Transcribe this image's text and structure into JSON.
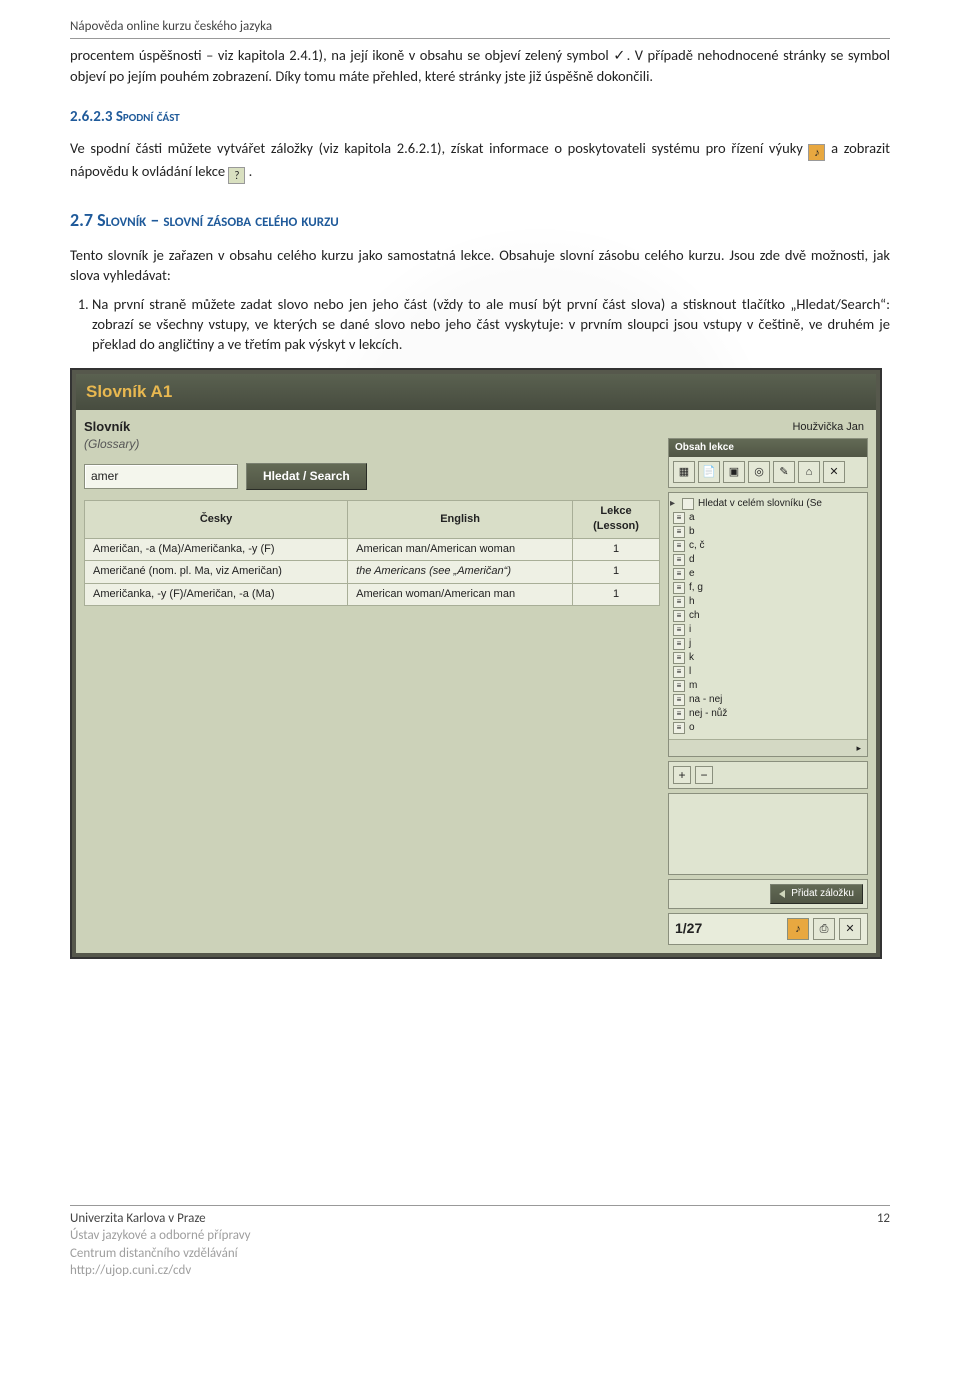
{
  "header": {
    "title": "Nápověda online kurzu českého jazyka"
  },
  "paragraphs": {
    "p1": "procentem úspěšnosti – viz kapitola 2.4.1), na její ikoně v obsahu se objeví zelený symbol ",
    "check": "✓",
    "p1b": ". V případě nehodnocené stránky se symbol objeví po jejím pouhém zobrazení. Díky tomu máte přehled, které stránky jste již úspěšně dokončili.",
    "h3": "2.6.2.3   Spodní část",
    "p2a": "Ve spodní části můžete vytvářet záložky (viz kapitola 2.6.2.1), získat informace o poskytovateli systému pro řízení výuky ",
    "p2b": " a zobrazit nápovědu k ovládání lekce ",
    "p2c": ".",
    "h2": "2.7   Slovník – slovní zásoba celého kurzu",
    "p3": "Tento slovník je zařazen v obsahu celého kurzu jako samostatná lekce. Obsahuje slovní zásobu celého kurzu. Jsou zde dvě možnosti, jak slova vyhledávat:",
    "li1": "Na první straně můžete zadat slovo nebo jen jeho část (vždy to ale musí být první část slova) a stisknout tlačítko „Hledat/Search“: zobrazí se všechny vstupy, ve kterých se dané slovo nebo jeho část vyskytuje: v prvním sloupci jsou vstupy v češtině, ve druhém je překlad do angličtiny a ve třetím pak výskyt v lekcích."
  },
  "inline_icons": {
    "audio": "♪",
    "help": "?"
  },
  "app": {
    "title": "Slovník A1",
    "user": "Houžvička Jan",
    "panel_label": "Slovník",
    "panel_sub": "(Glossary)",
    "search_value": "amer",
    "search_btn": "Hledat / Search",
    "table": {
      "headers": {
        "cz": "Česky",
        "en": "English",
        "lesson": "Lekce\n(Lesson)"
      },
      "rows": [
        {
          "cz": "Američan, -a (Ma)/Američanka, -y (F)",
          "en": "American man/American woman",
          "lesson": "1"
        },
        {
          "cz": "Američané (nom. pl. Ma, viz Američan)",
          "en": "the Americans (see „Američan“)",
          "en_italic": true,
          "lesson": "1"
        },
        {
          "cz": "Američanka, -y (F)/Američan, -a (Ma)",
          "en": "American woman/American man",
          "lesson": "1"
        }
      ]
    },
    "side": {
      "obsah_title": "Obsah lekce",
      "search_label": "Hledat v celém slovníku (Se",
      "nav": [
        "a",
        "b",
        "c, č",
        "d",
        "e",
        "f, g",
        "h",
        "ch",
        "i",
        "j",
        "k",
        "l",
        "m",
        "na - nej",
        "nej - nůž",
        "o"
      ],
      "bookmark_btn": "Přidat záložku",
      "counter": "1/27"
    }
  },
  "footer": {
    "l1": "Univerzita Karlova v Praze",
    "l2": "Ústav jazykové a odborné přípravy",
    "l3": "Centrum distančního vzdělávání",
    "l4": "http://ujop.cuni.cz/cdv",
    "page": "12"
  }
}
